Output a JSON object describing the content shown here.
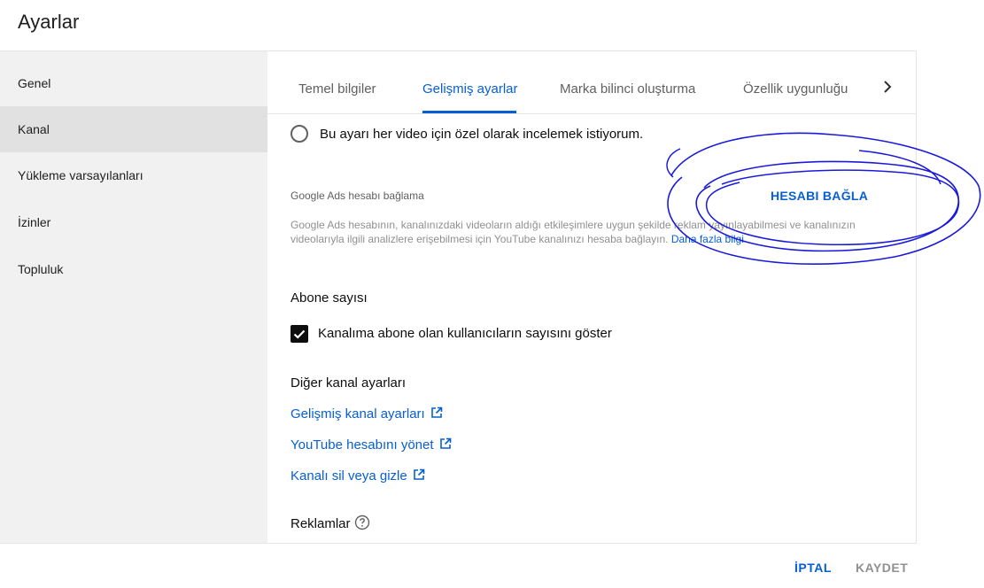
{
  "header": {
    "title": "Ayarlar"
  },
  "sidebar": {
    "items": [
      {
        "label": "Genel"
      },
      {
        "label": "Kanal"
      },
      {
        "label": "Yükleme varsayılanları"
      },
      {
        "label": "İzinler"
      },
      {
        "label": "Topluluk"
      }
    ],
    "active_index": 1
  },
  "tabs": {
    "items": [
      {
        "label": "Temel bilgiler"
      },
      {
        "label": "Gelişmiş ayarlar"
      },
      {
        "label": "Marka bilinci oluşturma"
      },
      {
        "label": "Özellik uygunluğu"
      }
    ],
    "active_index": 1,
    "next_icon": "chevron-right-icon"
  },
  "content": {
    "radio_label": "Bu ayarı her video için özel olarak incelemek istiyorum.",
    "ads": {
      "title": "Google Ads hesabı bağlama",
      "button": "HESABI BAĞLA",
      "description": "Google Ads hesabının, kanalınızdaki videoların aldığı etkileşimlere uygun şekilde reklam yayınlayabilmesi ve kanalınızın videolarıyla ilgili analizlere erişebilmesi için YouTube kanalınızı hesaba bağlayın.",
      "learn_more": "Daha fazla bilgi"
    },
    "subscribers": {
      "title": "Abone sayısı",
      "checkbox_label": "Kanalıma abone olan kullanıcıların sayısını göster",
      "checked": true
    },
    "other": {
      "title": "Diğer kanal ayarları",
      "links": [
        {
          "label": "Gelişmiş kanal ayarları"
        },
        {
          "label": "YouTube hesabını yönet"
        },
        {
          "label": "Kanalı sil veya gizle"
        }
      ]
    },
    "ads_section": {
      "title": "Reklamlar",
      "help_icon": "help-circle-icon"
    }
  },
  "footer": {
    "cancel": "İPTAL",
    "save": "KAYDET"
  },
  "colors": {
    "accent": "#065fd4",
    "scribble": "#1a1adb",
    "sidebar_bg": "#f1f1f1",
    "sidebar_active": "#e1e1e1"
  }
}
